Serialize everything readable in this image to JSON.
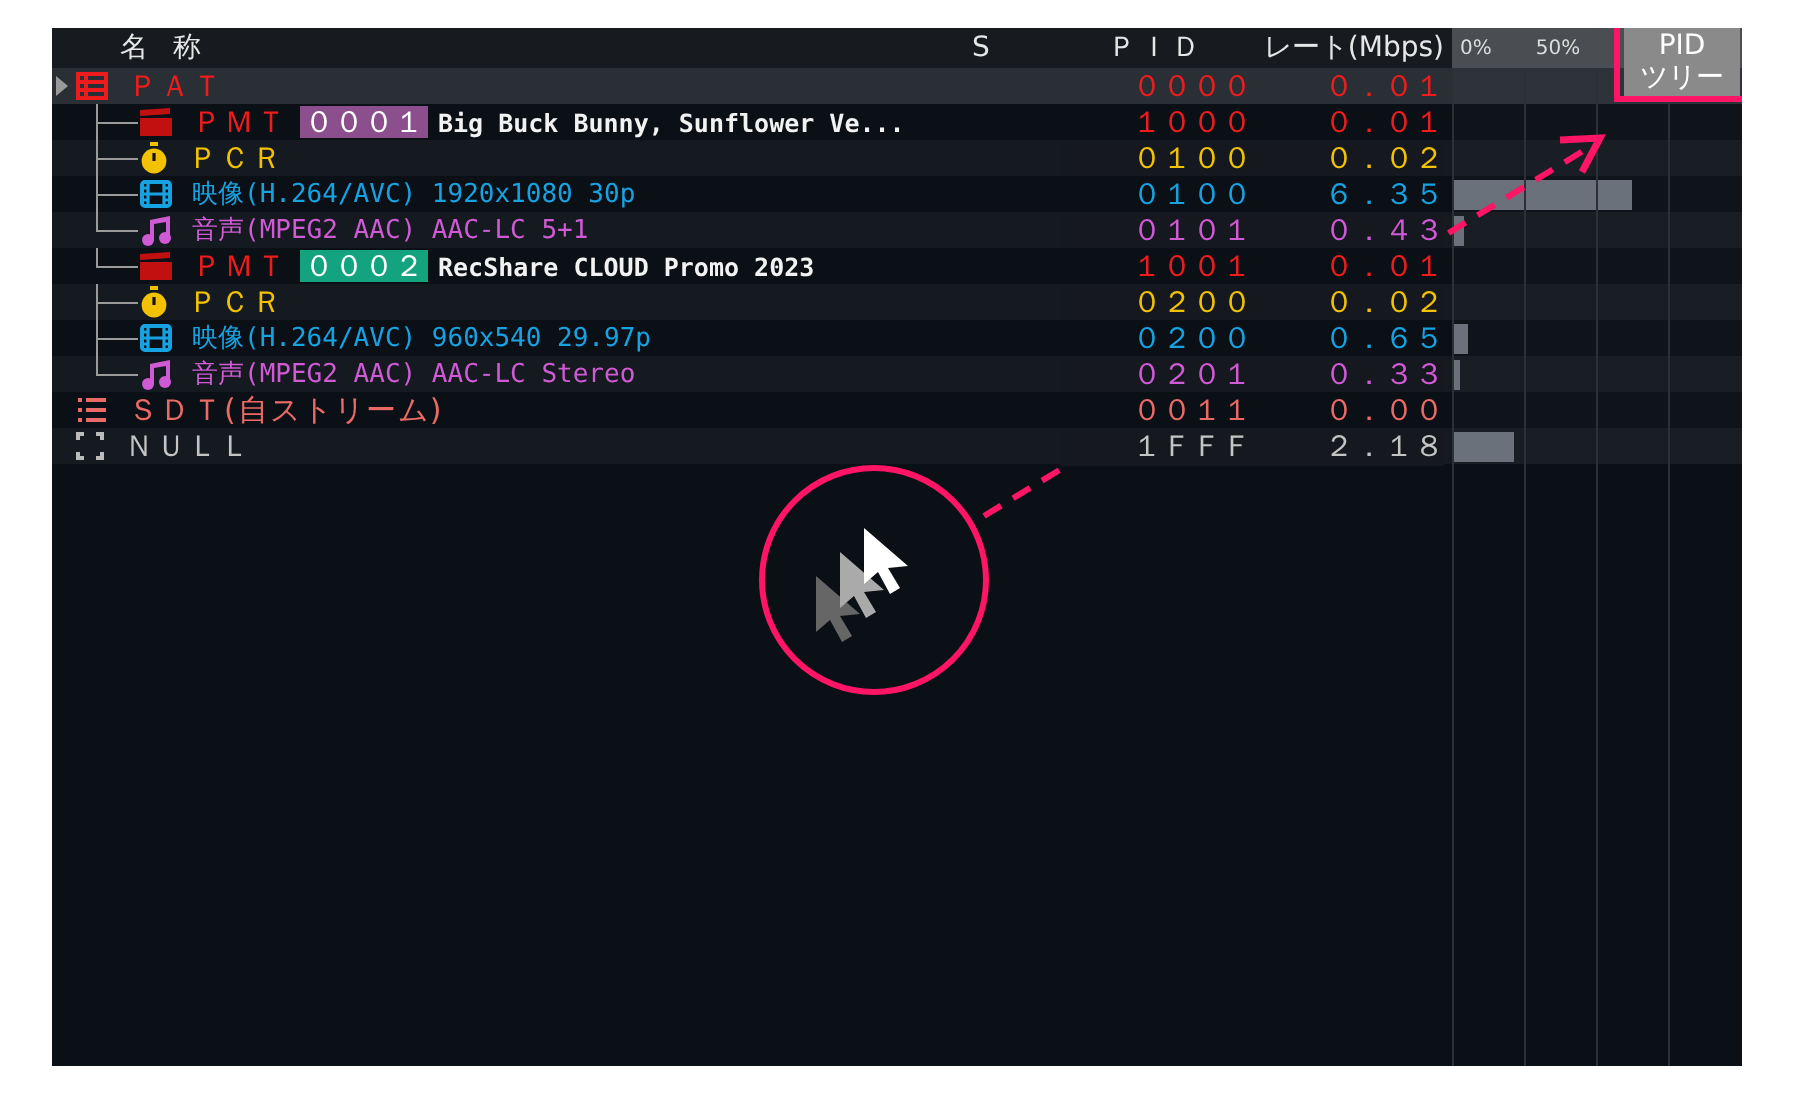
{
  "header": {
    "name": "名 称",
    "s": "S",
    "pid": "ＰＩＤ",
    "rate": "レート(Mbps)",
    "scale_start": "0%",
    "scale_mid": "50%"
  },
  "tree_button": {
    "label": "PID ツリー"
  },
  "streams": [
    {
      "kind": "pat",
      "label": "ＰＡＴ",
      "pid": "００００",
      "rate": "０．０１",
      "selected": true,
      "children": [
        {
          "kind": "pmt",
          "label": "ＰＭＴ",
          "number": "０００１",
          "color": "#8b4f8e",
          "title": "Big Buck Bunny, Sunflower Ve...",
          "pid": "１０００",
          "rate": "０．０１",
          "selected": false,
          "children": [
            {
              "kind": "pcr",
              "label": "ＰＣＲ",
              "pid": "０１００",
              "rate": "０．０２",
              "selected": false
            },
            {
              "kind": "video",
              "label": "映像(H.264/AVC) 1920x1080 30p",
              "pid": "０１００",
              "rate": "６．３５",
              "level": 0.62,
              "selected": false
            },
            {
              "kind": "audio",
              "label": "音声(MPEG2 AAC) AAC-LC 5+1",
              "pid": "０１０１",
              "rate": "０．４３",
              "level": 0.04,
              "selected": false
            }
          ]
        },
        {
          "kind": "pmt",
          "label": "ＰＭＴ",
          "number": "０００２",
          "color": "#14a37f",
          "title": "RecShare CLOUD Promo 2023",
          "pid": "１００１",
          "rate": "０．０１",
          "selected": false,
          "children": [
            {
              "kind": "pcr",
              "label": "ＰＣＲ",
              "pid": "０２００",
              "rate": "０．０２",
              "selected": false
            },
            {
              "kind": "video",
              "label": "映像(H.264/AVC) 960x540 29.97p",
              "pid": "０２００",
              "rate": "０．６５",
              "level": 0.055,
              "selected": false
            },
            {
              "kind": "audio",
              "label": "音声(MPEG2 AAC) AAC-LC Stereo",
              "pid": "０２０１",
              "rate": "０．３３",
              "level": 0.025,
              "selected": false
            }
          ]
        }
      ]
    },
    {
      "kind": "sdt",
      "label": "ＳＤＴ(自ストリーム)",
      "pid": "００１１",
      "rate": "０．００",
      "selected": false
    },
    {
      "kind": "null",
      "label": "ＮＵＬＬ",
      "pid": "１ＦＦＦ",
      "rate": "２．１８",
      "level": 0.215,
      "selected": false
    }
  ]
}
